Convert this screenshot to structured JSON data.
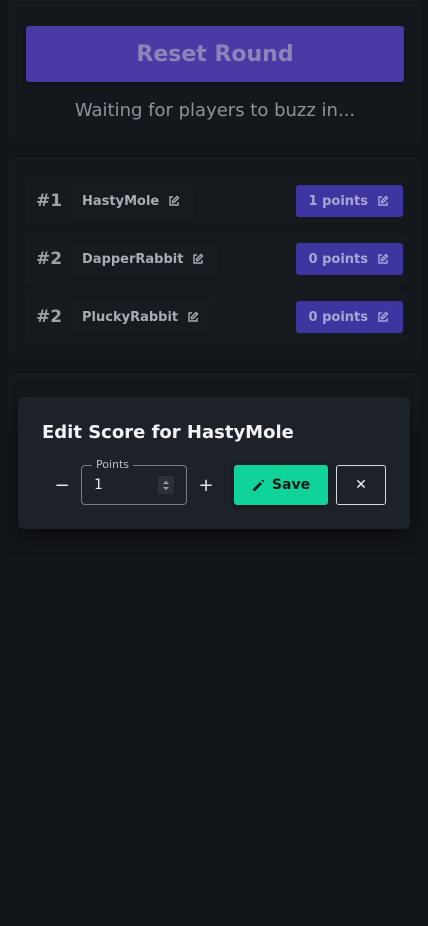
{
  "host": {
    "reset_label": "Reset Round",
    "waiting_text": "Waiting for players to buzz in..."
  },
  "leaderboard": {
    "rows": [
      {
        "rank": "#1",
        "name": "HastyMole",
        "points": "1 points"
      },
      {
        "rank": "#2",
        "name": "DapperRabbit",
        "points": "0 points"
      },
      {
        "rank": "#2",
        "name": "PluckyRabbit",
        "points": "0 points"
      }
    ]
  },
  "dialog": {
    "title": "Edit Score for HastyMole",
    "decrement_symbol": "−",
    "increment_symbol": "+",
    "points_label": "Points",
    "points_value": "1",
    "save_label": "Save",
    "close_symbol": "✕"
  },
  "icons": {
    "edit": "edit-icon",
    "pencil": "pencil-icon"
  },
  "colors": {
    "background": "#12151a",
    "accent_purple": "#4a3aa6",
    "points_purple": "#3f35a0",
    "save_green": "#10d39a"
  }
}
